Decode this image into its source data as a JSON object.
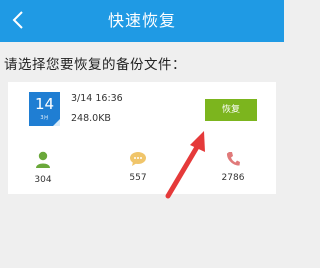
{
  "header": {
    "title": "快速恢复",
    "back_icon": "chevron-left-icon"
  },
  "prompt": "请选择您要恢复的备份文件：",
  "backup": {
    "day": "14",
    "month": "3月",
    "datetime": "3/14 16:36",
    "size": "248.0KB",
    "restore_label": "恢复"
  },
  "stats": [
    {
      "icon": "person-icon",
      "value": "304"
    },
    {
      "icon": "chat-bubble-icon",
      "value": "557"
    },
    {
      "icon": "phone-icon",
      "value": "2786"
    }
  ],
  "colors": {
    "header": "#1f9ae4",
    "calendar": "#1f7ed3",
    "restore_button": "#7cb51e",
    "contacts_icon": "#6aa83a",
    "sms_icon": "#f0c56a",
    "calls_icon": "#e07a7a",
    "annotation_arrow": "#e53a3a"
  }
}
